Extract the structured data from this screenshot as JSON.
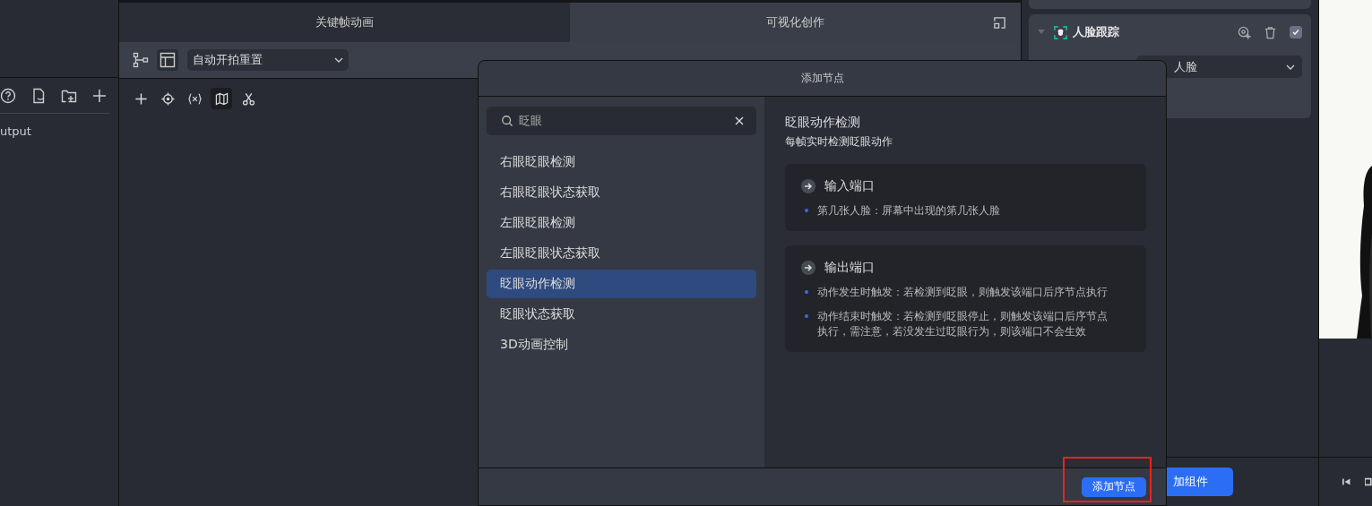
{
  "left_panel": {
    "items": [
      {
        "label": "utput"
      }
    ]
  },
  "tabs": [
    {
      "label": "关键帧动画",
      "selected": false
    },
    {
      "label": "可视化创作",
      "selected": true
    }
  ],
  "toolbar": {
    "view_buttons": [
      {
        "kind": "graph",
        "selected": false
      },
      {
        "kind": "layout",
        "selected": true
      }
    ],
    "dropdown": "自动开拍重置"
  },
  "canvas_tools": [
    {
      "kind": "plus",
      "selected": false
    },
    {
      "kind": "target",
      "selected": false
    },
    {
      "kind": "variable",
      "selected": false
    },
    {
      "kind": "map",
      "selected": true
    },
    {
      "kind": "scissors",
      "selected": false
    }
  ],
  "right_panel": {
    "component": {
      "title": "人脸跟踪",
      "expanded": true,
      "enabled": true,
      "dropdown": "人脸"
    },
    "add_button": "加组件"
  },
  "dialog": {
    "title": "添加节点",
    "search": {
      "value": "眨眼"
    },
    "results": [
      {
        "label": "右眼眨眼检测",
        "selected": false
      },
      {
        "label": "右眼眨眼状态获取",
        "selected": false
      },
      {
        "label": "左眼眨眼检测",
        "selected": false
      },
      {
        "label": "左眼眨眼状态获取",
        "selected": false
      },
      {
        "label": "眨眼动作检测",
        "selected": true
      },
      {
        "label": "眨眼状态获取",
        "selected": false
      },
      {
        "label": "3D动画控制",
        "selected": false
      }
    ],
    "detail": {
      "title": "眨眼动作检测",
      "subtitle": "每帧实时检测眨眼动作",
      "sections": [
        {
          "title": "输入端口",
          "items": [
            "第几张人脸：屏幕中出现的第几张人脸"
          ]
        },
        {
          "title": "输出端口",
          "items": [
            "动作发生时触发：若检测到眨眼，则触发该端口后序节点执行",
            "动作结束时触发：若检测到眨眼停止，则触发该端口后序节点执行，需注意，若没发生过眨眼行为，则该端口不会生效"
          ]
        }
      ]
    },
    "confirm_button": "添加节点",
    "confirm_highlighted": true
  }
}
